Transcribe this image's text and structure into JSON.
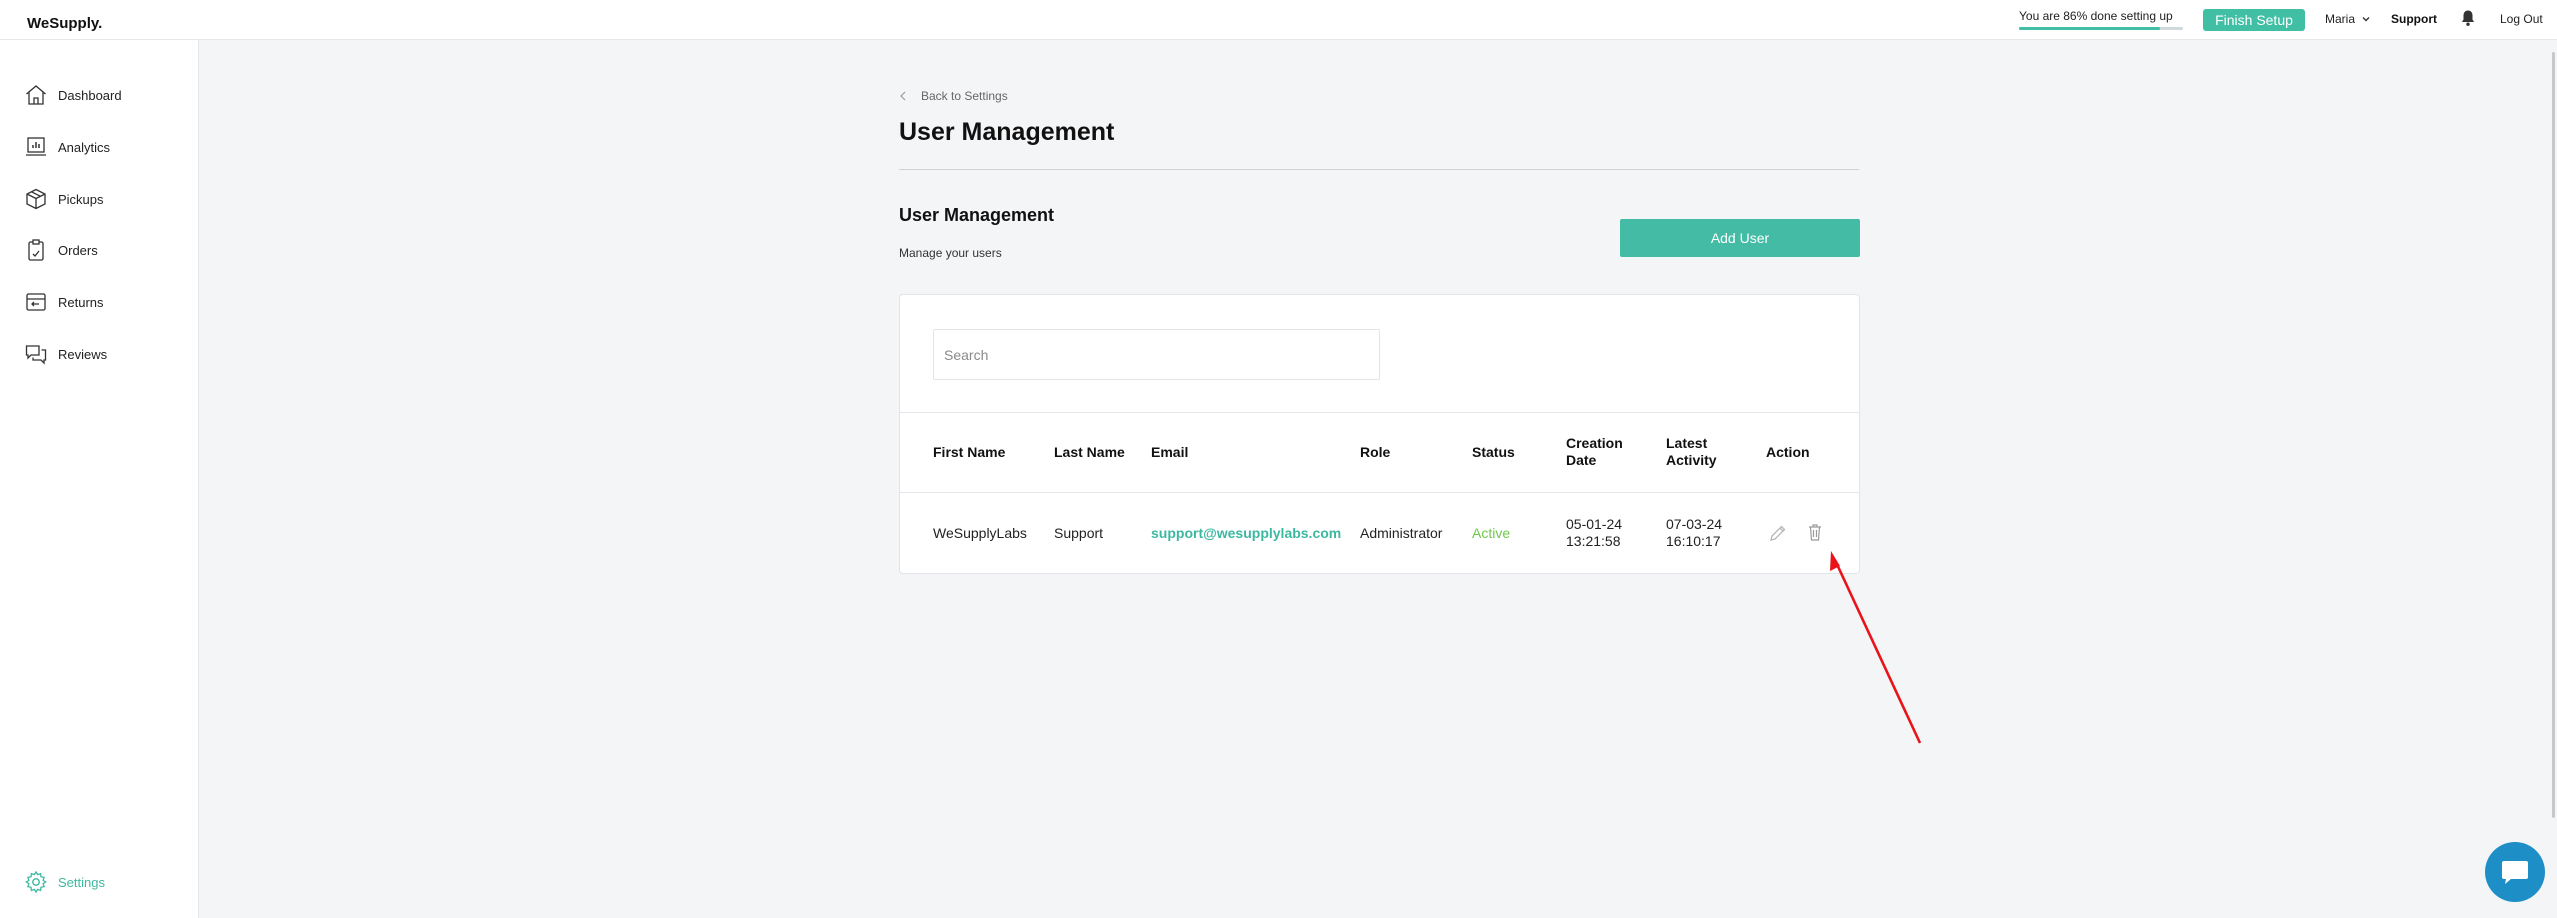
{
  "brand": {
    "logo": "WeSupply."
  },
  "topbar": {
    "progress_text": "You are 86% done setting up",
    "progress_percent": 86,
    "finish_label": "Finish Setup",
    "user_name": "Maria",
    "support_label": "Support",
    "logout_label": "Log Out"
  },
  "sidebar": {
    "items": [
      {
        "label": "Dashboard",
        "icon": "home-icon"
      },
      {
        "label": "Analytics",
        "icon": "analytics-icon"
      },
      {
        "label": "Pickups",
        "icon": "box-icon"
      },
      {
        "label": "Orders",
        "icon": "orders-icon"
      },
      {
        "label": "Returns",
        "icon": "returns-icon"
      },
      {
        "label": "Reviews",
        "icon": "reviews-icon"
      }
    ],
    "settings_label": "Settings"
  },
  "main": {
    "back_label": "Back to Settings",
    "page_title": "User Management",
    "section_title": "User Management",
    "section_subtitle": "Manage your users",
    "add_user_label": "Add User",
    "search_placeholder": "Search",
    "table": {
      "headers": [
        "First Name",
        "Last Name",
        "Email",
        "Role",
        "Status",
        "Creation Date",
        "Latest Activity",
        "Action"
      ],
      "rows": [
        {
          "first_name": "WeSupplyLabs",
          "last_name": "Support",
          "email": "support@wesupplylabs.com",
          "role": "Administrator",
          "status": "Active",
          "creation_date": "05-01-24",
          "creation_time": "13:21:58",
          "latest_date": "07-03-24",
          "latest_time": "16:10:17"
        }
      ]
    }
  },
  "colors": {
    "accent": "#40bfa5",
    "active_status": "#6fc94d",
    "annotation_arrow": "#e8141a",
    "chat": "#1e8fc6"
  }
}
